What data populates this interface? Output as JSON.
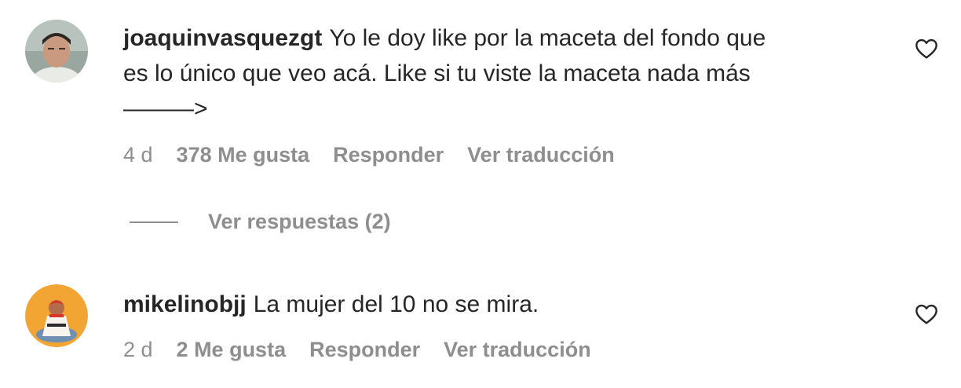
{
  "comments": [
    {
      "username": "joaquinvasquezgt",
      "text_line1": "Yo le doy like por la maceta del fondo que",
      "text_line2": "es lo único que veo acá. Like si tu viste la maceta nada más",
      "text_line3": "———>",
      "time": "4 d",
      "likes": "378 Me gusta",
      "reply_label": "Responder",
      "translate_label": "Ver traducción",
      "avatar_icon": "user-avatar-photo",
      "like_icon": "heart-outline-icon"
    },
    {
      "username": "mikelinobjj",
      "text_line1": "La mujer del 10 no se mira.",
      "time": "2 d",
      "likes": "2 Me gusta",
      "reply_label": "Responder",
      "translate_label": "Ver traducción",
      "avatar_icon": "user-avatar-illustration",
      "like_icon": "heart-outline-icon"
    }
  ],
  "view_replies": "Ver respuestas (2)",
  "colors": {
    "text": "#262626",
    "secondary": "#8e8e8e",
    "background": "#ffffff"
  }
}
